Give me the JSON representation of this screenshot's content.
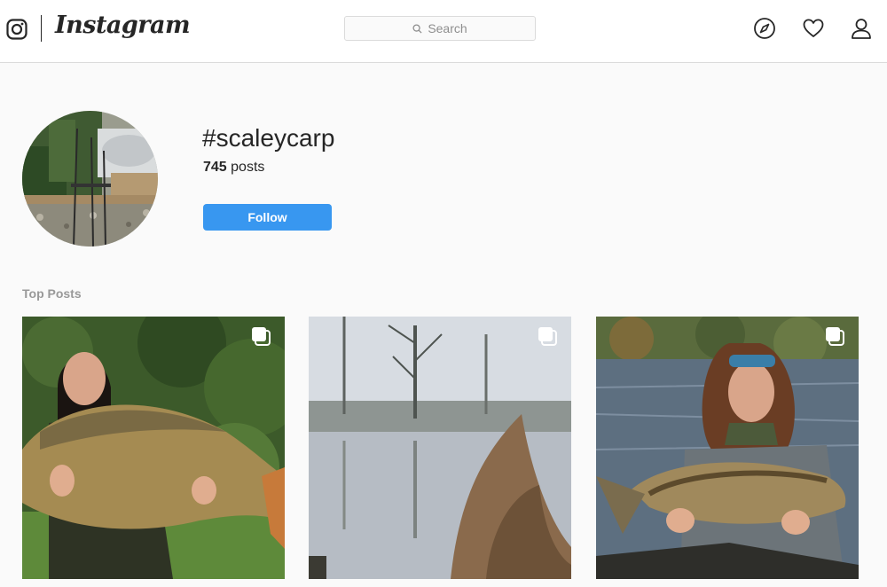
{
  "header": {
    "brand": "Instagram",
    "search_placeholder": "Search",
    "icons": [
      "instagram-glyph-icon",
      "explore-compass-icon",
      "activity-heart-icon",
      "profile-person-icon"
    ]
  },
  "hashtag": {
    "title": "#scaleycarp",
    "post_count": "745",
    "post_count_label": "posts",
    "follow_label": "Follow"
  },
  "top_posts": {
    "heading": "Top Posts",
    "items": [
      {
        "description": "Woman in green jacket kneeling and holding a large mirror carp",
        "multi_image": true
      },
      {
        "description": "Misty lake with bare trees reflected and reeds in the foreground",
        "multi_image": true
      },
      {
        "description": "Woman in blue headband holding a mirror carp in front of a lake",
        "multi_image": true
      }
    ]
  },
  "colors": {
    "accent": "#3897f0",
    "text": "#262626",
    "muted": "#999999",
    "border": "#dbdbdb",
    "background": "#fafafa"
  }
}
